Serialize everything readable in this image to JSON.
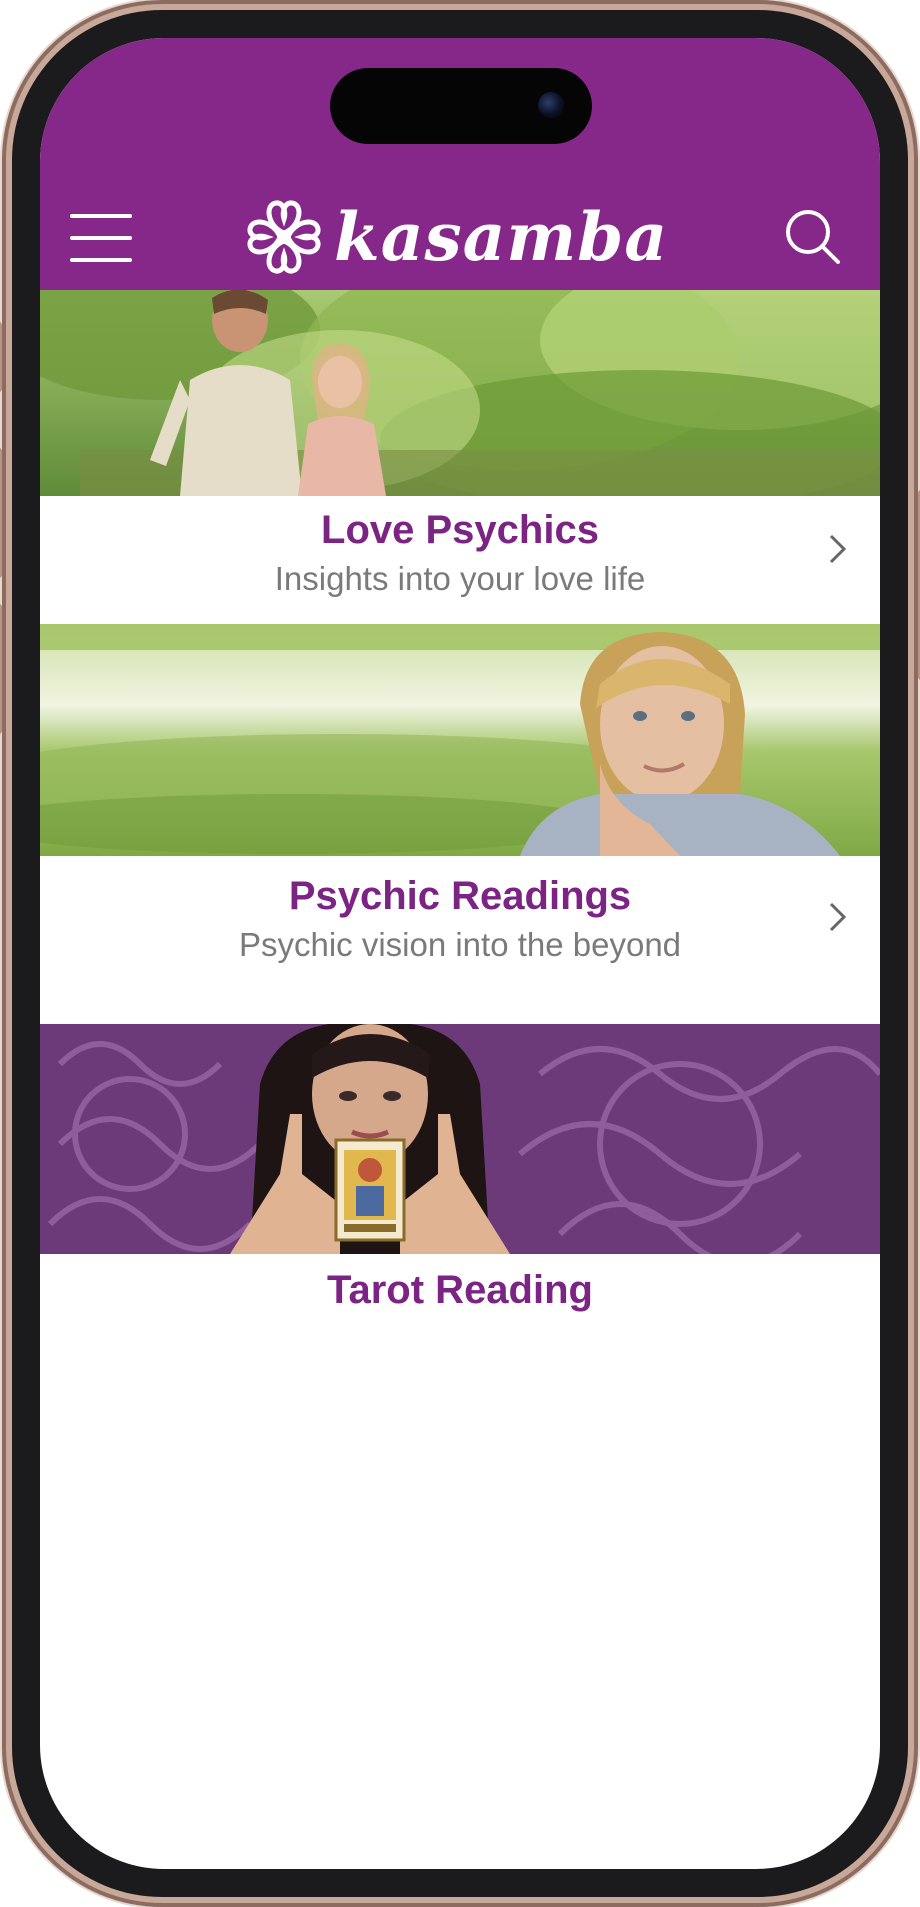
{
  "app": {
    "brand_name": "kasamba",
    "colors": {
      "brand_purple": "#86288a",
      "title_purple": "#7c2484",
      "subtitle_gray": "#7a7a7a"
    }
  },
  "header": {
    "menu_icon": "hamburger-menu-icon",
    "search_icon": "search-icon",
    "logo_icon": "kasamba-flower-logo-icon"
  },
  "categories": [
    {
      "title": "Love Psychics",
      "subtitle": "Insights into your love life",
      "image": "couple-walking-in-park",
      "icon": "chevron-right-icon"
    },
    {
      "title": "Psychic Readings",
      "subtitle": "Psychic vision into the beyond",
      "image": "woman-resting-chin-on-hand",
      "icon": "chevron-right-icon"
    },
    {
      "title": "Tarot Reading",
      "subtitle": "",
      "image": "woman-holding-tarot-card",
      "icon": ""
    }
  ]
}
